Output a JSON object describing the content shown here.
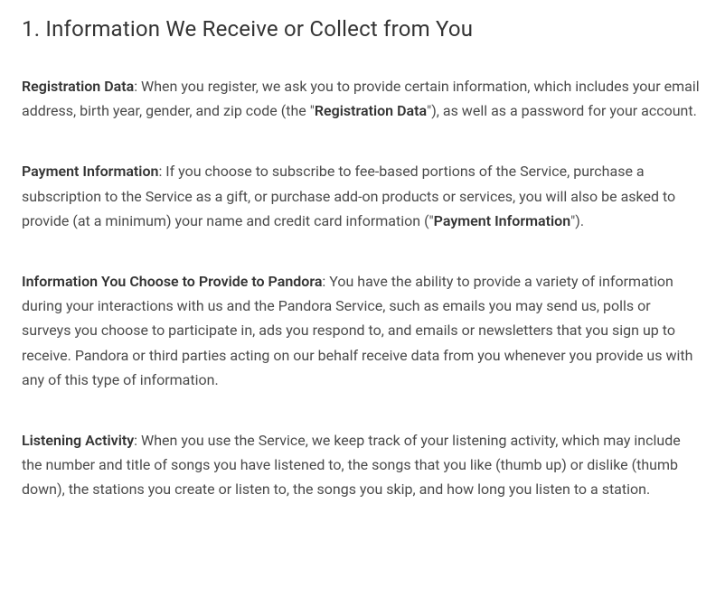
{
  "heading": "1. Information We Receive or Collect from You",
  "paragraphs": [
    {
      "label": "Registration Data",
      "text_pre": ": When you register, we ask you to provide certain information, which includes your email address, birth year, gender, and zip code (the \"",
      "bold_mid": "Registration Data",
      "text_post": "\"), as well as a password for your account."
    },
    {
      "label": "Payment Information",
      "text_pre": ": If you choose to subscribe to fee-based portions of the Service, purchase a subscription to the Service as a gift, or purchase add-on products or services, you will also be asked to provide (at a minimum) your name and credit card information (\"",
      "bold_mid": "Payment Information",
      "text_post": "\")."
    },
    {
      "label": "Information You Choose to Provide to Pandora",
      "text_pre": ": You have the ability to provide a variety of information during your interactions with us and the Pandora Service, such as emails you may send us, polls or surveys you choose to participate in, ads you respond to, and emails or newsletters that you sign up to receive. Pandora or third parties acting on our behalf receive data from you whenever you provide us with any of this type of information.",
      "bold_mid": "",
      "text_post": ""
    },
    {
      "label": "Listening Activity",
      "text_pre": ": When you use the Service, we keep track of your listening activity, which may include the number and title of songs you have listened to, the songs that you like (thumb up) or dislike (thumb down), the stations you create or listen to, the songs you skip, and how long you listen to a station.",
      "bold_mid": "",
      "text_post": ""
    }
  ]
}
